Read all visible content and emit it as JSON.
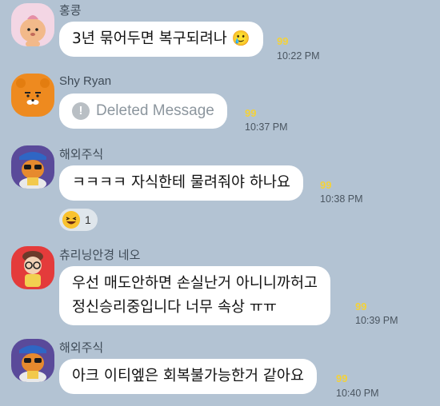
{
  "colors": {
    "background": "#b3c3d3",
    "bubble": "#ffffff",
    "unread": "#f4d23a"
  },
  "messages": [
    {
      "sender": "홍콩",
      "avatar_icon": "apeach-avatar-icon",
      "text": "3년 묶어두면 복구되려나 🥲",
      "unread": "99",
      "time": "10:22 PM"
    },
    {
      "sender": "Shy Ryan",
      "avatar_icon": "ryan-avatar-icon",
      "text": "Deleted Message",
      "deleted": true,
      "unread": "99",
      "time": "10:37 PM"
    },
    {
      "sender": "해외주식",
      "avatar_icon": "ryan-sunglasses-avatar-icon",
      "text": "ㅋㅋㅋㅋ 자식한테 물려줘야 하나요",
      "unread": "99",
      "time": "10:38 PM",
      "reaction": {
        "icon": "laughing-emoji-icon",
        "count": "1"
      }
    },
    {
      "sender": "츄리닝안경 네오",
      "avatar_icon": "neo-avatar-icon",
      "lines": [
        "우선 매도안하면 손실난거 아니니까허고",
        "정신승리중입니다 너무 속상 ㅠㅠ"
      ],
      "unread": "99",
      "time": "10:39 PM"
    },
    {
      "sender": "해외주식",
      "avatar_icon": "ryan-sunglasses-avatar-icon",
      "text": "아크 이티엪은 회복불가능한거 같아요",
      "unread": "99",
      "time": "10:40 PM"
    }
  ]
}
